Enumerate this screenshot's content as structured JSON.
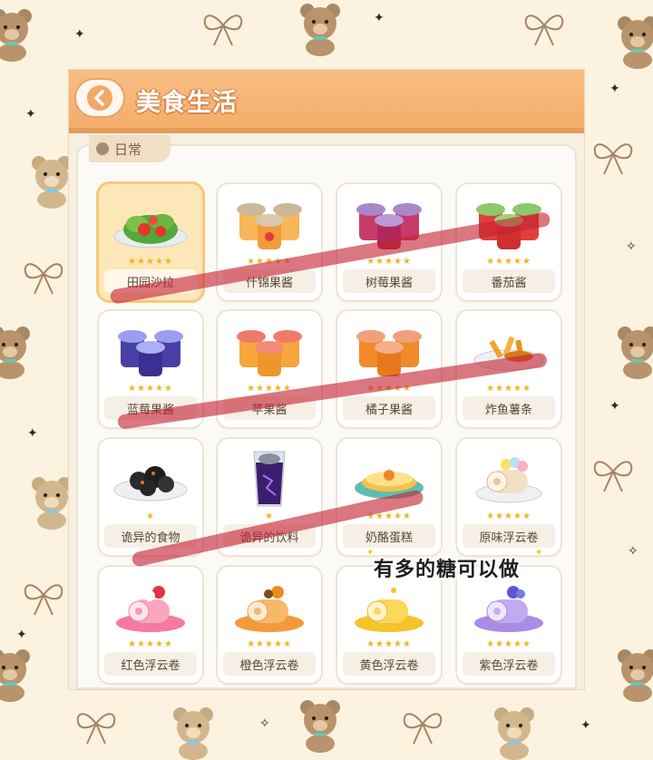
{
  "screen": {
    "title": "美食生活"
  },
  "category_tab": {
    "label": "日常"
  },
  "rating_stars": "★★★★★",
  "items": [
    {
      "name": "田园沙拉",
      "icon": "salad-icon",
      "selected": true
    },
    {
      "name": "什锦果酱",
      "icon": "mixed-jam-icon"
    },
    {
      "name": "树莓果酱",
      "icon": "raspberry-jam-icon"
    },
    {
      "name": "番茄酱",
      "icon": "ketchup-jar-icon"
    },
    {
      "name": "蓝莓果酱",
      "icon": "blueberry-jam-icon"
    },
    {
      "name": "苹果酱",
      "icon": "apple-jam-icon"
    },
    {
      "name": "橘子果酱",
      "icon": "orange-jam-icon"
    },
    {
      "name": "炸鱼薯条",
      "icon": "fish-and-chips-icon"
    },
    {
      "name": "诡异的食物",
      "icon": "weird-food-icon"
    },
    {
      "name": "诡异的饮料",
      "icon": "weird-drink-icon"
    },
    {
      "name": "奶酪蛋糕",
      "icon": "cheesecake-icon"
    },
    {
      "name": "原味浮云卷",
      "icon": "plain-cloud-roll-icon"
    },
    {
      "name": "红色浮云卷",
      "icon": "red-cloud-roll-icon"
    },
    {
      "name": "橙色浮云卷",
      "icon": "orange-cloud-roll-icon"
    },
    {
      "name": "黄色浮云卷",
      "icon": "yellow-cloud-roll-icon"
    },
    {
      "name": "紫色浮云卷",
      "icon": "purple-cloud-roll-icon"
    }
  ],
  "annotation": {
    "text": "有多的糖可以做"
  },
  "colors": {
    "header": "#f4ad6b",
    "strike": "#c42434",
    "star": "#f2b423"
  }
}
